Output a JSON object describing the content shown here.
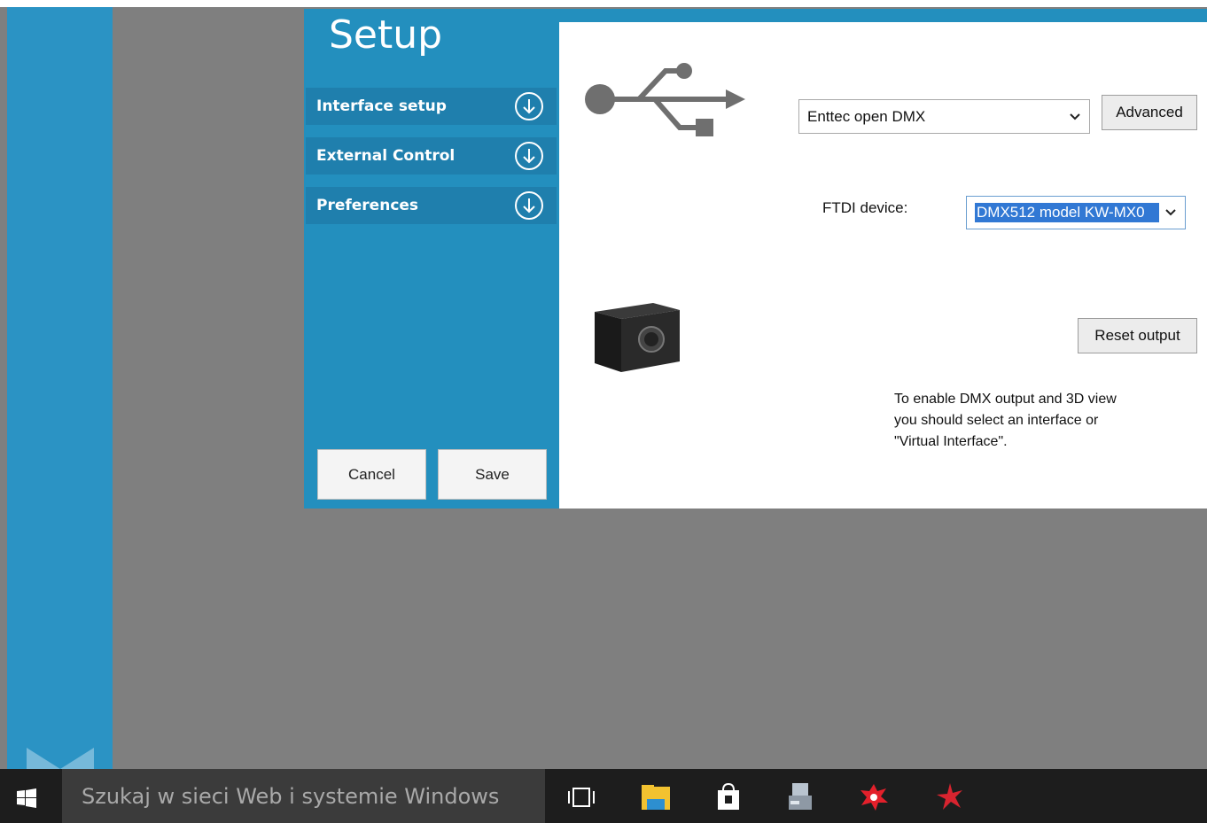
{
  "setup": {
    "title": "Setup",
    "nav": [
      {
        "label": "Interface setup"
      },
      {
        "label": "External Control"
      },
      {
        "label": "Preferences"
      }
    ],
    "cancel_label": "Cancel",
    "save_label": "Save"
  },
  "interface": {
    "selected_interface": "Enttec open DMX",
    "advanced_label": "Advanced",
    "ftdi_label": "FTDI device:",
    "ftdi_value": "DMX512 model KW-MX0",
    "reset_label": "Reset output",
    "info_lines": [
      "To enable DMX output and 3D view",
      "you should select an interface or",
      "\"Virtual Interface\"."
    ]
  },
  "taskbar": {
    "search_placeholder": "Szukaj w sieci Web i systemie Windows"
  },
  "colors": {
    "accent": "#238fbe",
    "rail": "#2b93c4",
    "desktop": "#7f7f7f",
    "selection": "#3178d4",
    "taskbar": "#1d1d1d"
  },
  "icons": [
    "usb-icon",
    "arrow-down-circle-icon",
    "chevron-down-icon",
    "windows-logo-icon",
    "task-view-icon",
    "file-explorer-icon",
    "store-icon",
    "app-installer-icon",
    "splat-app-icon",
    "star-app-icon"
  ]
}
